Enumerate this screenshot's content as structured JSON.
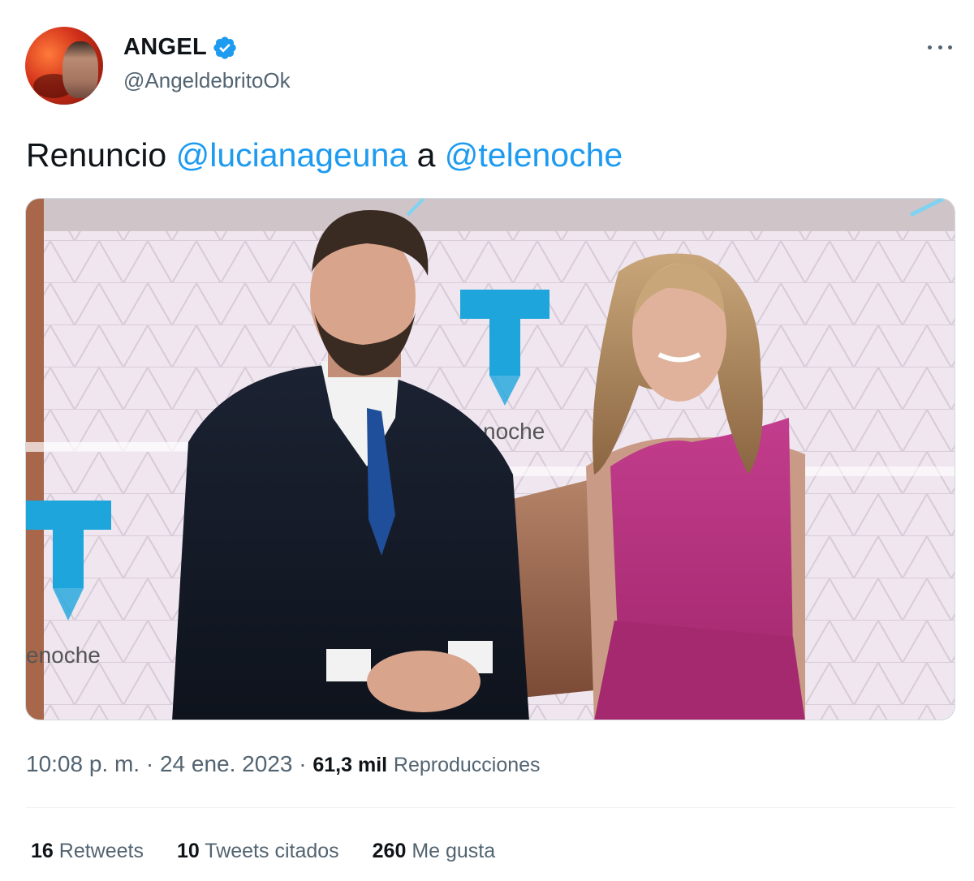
{
  "author": {
    "display_name": "ANGEL",
    "handle": "@AngeldebritoOk",
    "verified": true
  },
  "tweet": {
    "text_parts": [
      "Renuncio ",
      "@lucianageuna",
      " a ",
      "@telenoche"
    ]
  },
  "media": {
    "sign_text_1": "noche",
    "sign_text_2": "enoche",
    "brand_color": "#1ea6dc"
  },
  "meta": {
    "time": "10:08 p. m.",
    "separator": "·",
    "date": "24 ene. 2023",
    "views_count": "61,3 mil",
    "views_label": "Reproducciones"
  },
  "stats": [
    {
      "count": "16",
      "label": "Retweets"
    },
    {
      "count": "10",
      "label": "Tweets citados"
    },
    {
      "count": "260",
      "label": "Me gusta"
    }
  ],
  "colors": {
    "link": "#1d9bf0",
    "secondary_text": "#536471",
    "primary_text": "#0f1419"
  }
}
